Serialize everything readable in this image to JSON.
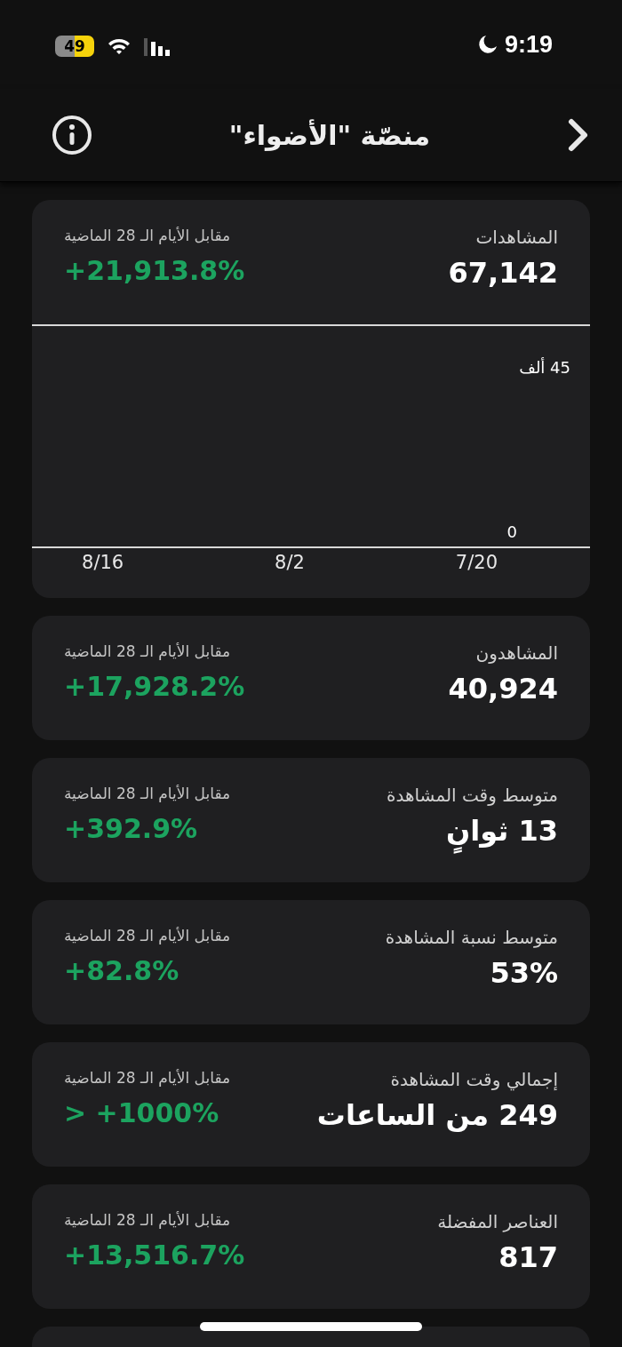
{
  "status_bar": {
    "time": "9:19",
    "battery": "49"
  },
  "nav": {
    "title": "منصّة \"الأضواء\""
  },
  "cards": [
    {
      "label": "المشاهدات",
      "value": "67,142",
      "compare_label": "مقابل الأيام الـ 28 الماضية",
      "change": "+21,913.8%",
      "chart": {
        "y_labels": [
          "45 ألف",
          "0"
        ],
        "x_labels": [
          "7/20",
          "8/2",
          "8/16"
        ]
      }
    },
    {
      "label": "المشاهدون",
      "value": "40,924",
      "compare_label": "مقابل الأيام الـ 28 الماضية",
      "change": "+17,928.2%"
    },
    {
      "label": "متوسط وقت المشاهدة",
      "value": "13 ثوانٍ",
      "compare_label": "مقابل الأيام الـ 28 الماضية",
      "change": "+392.9%"
    },
    {
      "label": "متوسط نسبة المشاهدة",
      "value": "53%",
      "compare_label": "مقابل الأيام الـ 28 الماضية",
      "change": "+82.8%"
    },
    {
      "label": "إجمالي وقت المشاهدة",
      "value": "249 من الساعات",
      "compare_label": "مقابل الأيام الـ 28 الماضية",
      "change": "> +1000%"
    },
    {
      "label": "العناصر المفضلة",
      "value": "817",
      "compare_label": "مقابل الأيام الـ 28 الماضية",
      "change": "+13,516.7%"
    }
  ]
}
